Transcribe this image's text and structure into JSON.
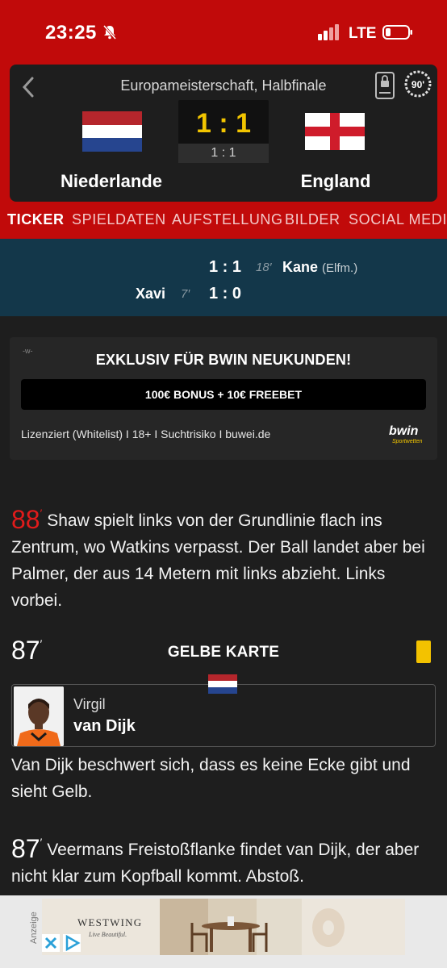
{
  "status_bar": {
    "time": "23:25",
    "network": "LTE"
  },
  "match": {
    "competition": "Europameisterschaft, Halbfinale",
    "minute_badge": "90'",
    "home_team": "Niederlande",
    "away_team": "England",
    "score": "1 : 1",
    "halftime_score": "1 : 1"
  },
  "tabs": [
    "TICKER",
    "SPIELDATEN",
    "AUFSTELLUNG",
    "BILDER",
    "SOCIAL MEDIA"
  ],
  "goals": [
    {
      "score": "1 : 1",
      "minute": "18",
      "player": "Kane",
      "note": "(Elfm.)",
      "side": "away"
    },
    {
      "score": "1 : 0",
      "minute": "7",
      "player": "Xavi",
      "note": "",
      "side": "home"
    }
  ],
  "ad": {
    "mark": "-w-",
    "title": "EXKLUSIV FÜR BWIN NEUKUNDEN!",
    "button": "100€ BONUS + 10€ FREEBET",
    "legal": "Lizenziert (Whitelist) I 18+ I Suchtrisiko I buwei.de",
    "brand": "bwin",
    "brand_sub": "Sportwetten"
  },
  "ticker": [
    {
      "minute": "88",
      "text": "Shaw spielt links von der Grundlinie flach ins Zentrum, wo Watkins verpasst. Der Ball landet aber bei Palmer, der aus 14 Metern mit links abzieht. Links vorbei."
    },
    {
      "minute": "87",
      "event": "GELBE KARTE",
      "player_first": "Virgil",
      "player_last": "van Dijk",
      "text": "Van Dijk beschwert sich, dass es keine Ecke gibt und sieht Gelb."
    },
    {
      "minute": "87",
      "text": "Veermans Freistoßflanke findet van Dijk, der aber nicht klar zum Kopfball kommt. Abstoß."
    }
  ],
  "bottom_ad": {
    "label": "Anzeige",
    "brand": "WESTWING",
    "tagline": "Live Beautiful."
  },
  "colors": {
    "header_red": "#c10a0a",
    "score_yellow": "#f2c500",
    "goal_band": "#13374a",
    "live_minute": "#e01b1b"
  }
}
